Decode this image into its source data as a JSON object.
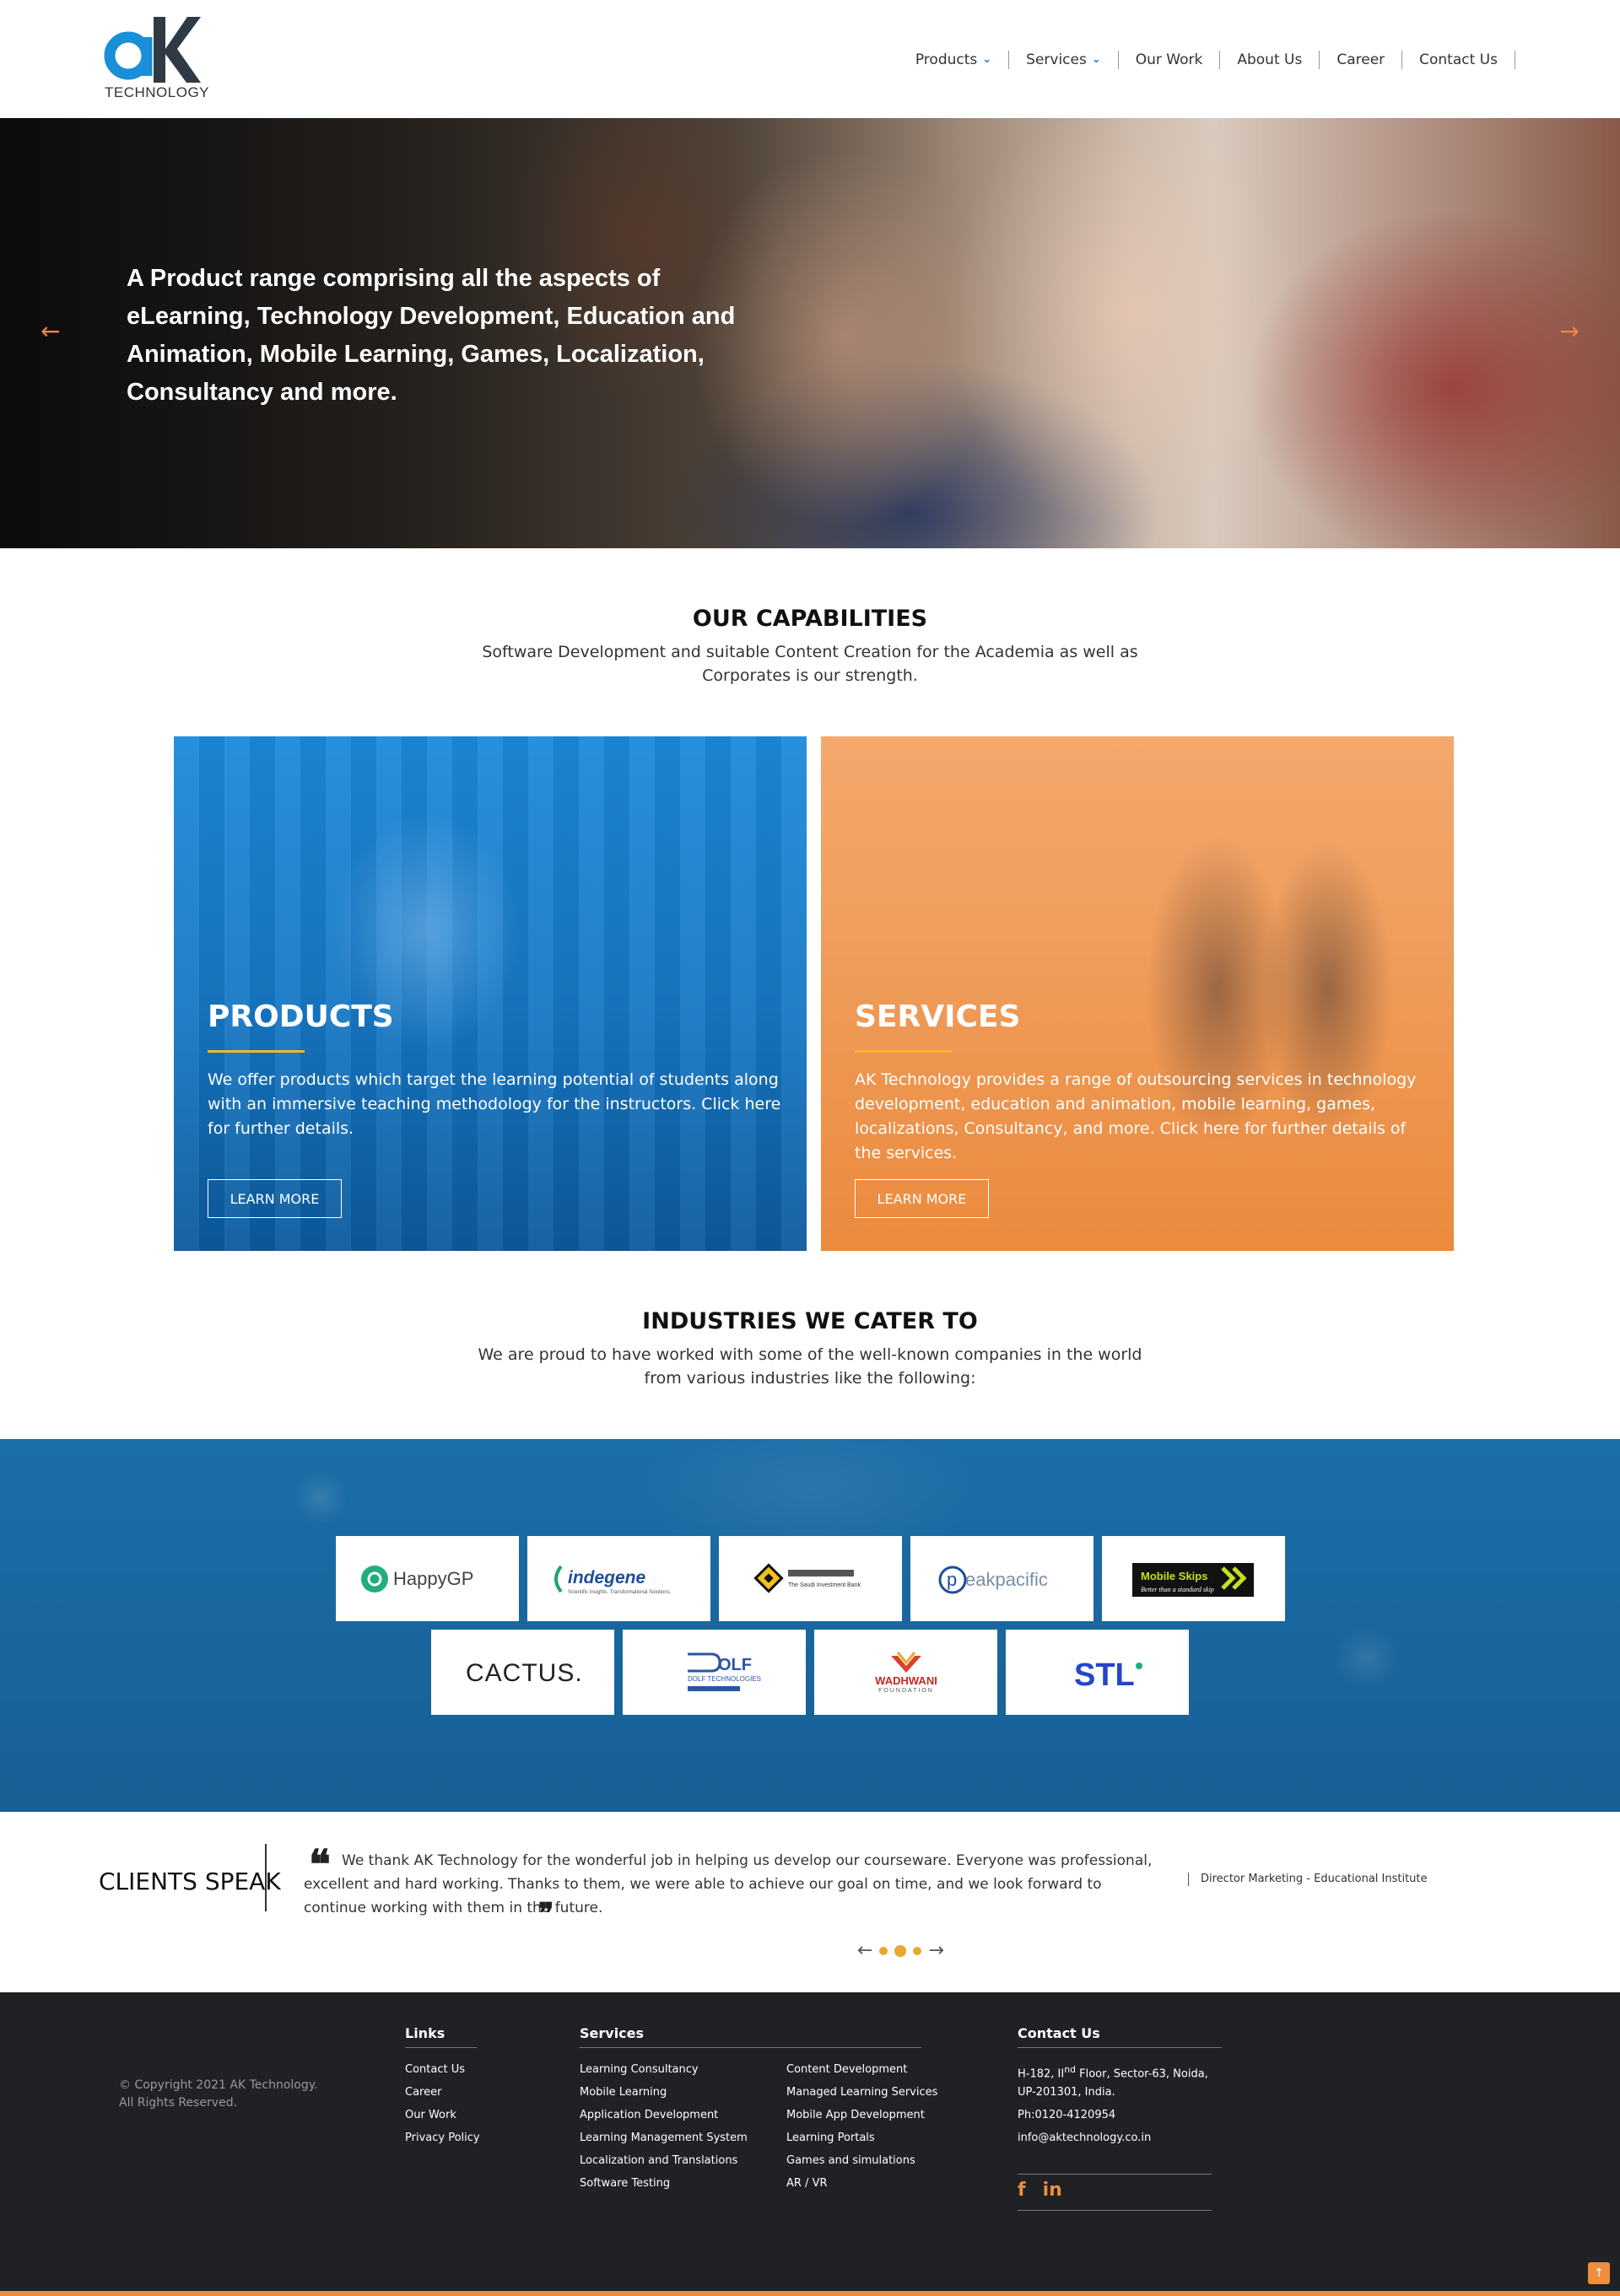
{
  "header": {
    "logo_word": "TECHNOLOGY",
    "nav": [
      {
        "label": "Products",
        "dropdown": true
      },
      {
        "label": "Services",
        "dropdown": true
      },
      {
        "label": "Our Work",
        "dropdown": false
      },
      {
        "label": "About Us",
        "dropdown": false
      },
      {
        "label": "Career",
        "dropdown": false
      },
      {
        "label": "Contact Us",
        "dropdown": false
      }
    ]
  },
  "hero": {
    "text": "A Product range comprising all the aspects of eLearning, Technology Development, Education and Animation, Mobile Learning, Games, Localization, Consultancy and more.",
    "prev_icon": "arrow-left-icon",
    "next_icon": "arrow-right-icon"
  },
  "capabilities": {
    "title": "OUR CAPABILITIES",
    "subtitle": "Software Development and suitable Content Creation for the Academia as well as Corporates is our strength.",
    "cards": [
      {
        "title": "PRODUCTS",
        "text": "We offer products which target the learning potential of students along with an immersive teaching methodology for the instructors. Click here for further details.",
        "button": "LEARN MORE"
      },
      {
        "title": "SERVICES",
        "text": "AK Technology provides a range of outsourcing services in technology development, education and animation, mobile learning, games, localizations, Consultancy, and more. Click here for further details of the services.",
        "button": "LEARN MORE"
      }
    ]
  },
  "industries": {
    "title": "INDUSTRIES WE CATER TO",
    "subtitle": "We are proud to have worked with some of the well-known companies in the world from various industries like the following:",
    "logos": {
      "happygp": "HappyGP",
      "indegene": "indegene",
      "indegene_tag": "Scientific Insights. Transformational Solutions.",
      "saudi_bank": "The Saudi Investment Bank",
      "peakpacific": "eakpacific",
      "peakpacific_p": "p",
      "mobileskips": "Mobile Skips",
      "mobileskips_tag": "Better than a standard skip",
      "cactus": "CACTUS.",
      "dolf": "OLF",
      "dolf_sub": "DOLF TECHNOLOGIES",
      "wadhwani": "WADHWANI",
      "wadhwani_sub": "FOUNDATION",
      "stl": "STL"
    }
  },
  "clients": {
    "title": "CLIENTS SPEAK",
    "quote": "We thank AK Technology for the wonderful job in helping us develop our courseware. Everyone was professional, excellent and hard working. Thanks to them, we were able to achieve our goal on time, and we look forward to continue working with them in the future.",
    "author": "Director Marketing - Educational Institute"
  },
  "footer": {
    "copyright_line1": "© Copyright 2021 AK Technology.",
    "copyright_line2": "All Rights Reserved.",
    "links_title": "Links",
    "links": [
      "Contact Us",
      "Career",
      "Our Work",
      "Privacy Policy"
    ],
    "services_title": "Services",
    "services_col1": [
      "Learning Consultancy",
      "Mobile Learning",
      "Application Development",
      "Learning Management System",
      "Localization and Translations",
      "Software Testing"
    ],
    "services_col2": [
      "Content Development",
      "Managed Learning Services",
      "Mobile App Development",
      "Learning Portals",
      "Games and simulations",
      "AR / VR"
    ],
    "contact_title": "Contact Us",
    "contact": {
      "address_prefix": "H-182, II",
      "address_sup": "nd",
      "address_suffix": " Floor, Sector-63, Noida,",
      "address_line2": "UP-201301, India.",
      "phone": "Ph:0120-4120954",
      "email": "info@aktechnology.co.in"
    },
    "social": [
      "facebook-icon",
      "linkedin-icon"
    ]
  },
  "colors": {
    "brand_blue": "#1a73c6",
    "brand_orange": "#ef8e3c",
    "accent_yellow": "#f3b62f",
    "footer_bg": "#1f2124"
  }
}
